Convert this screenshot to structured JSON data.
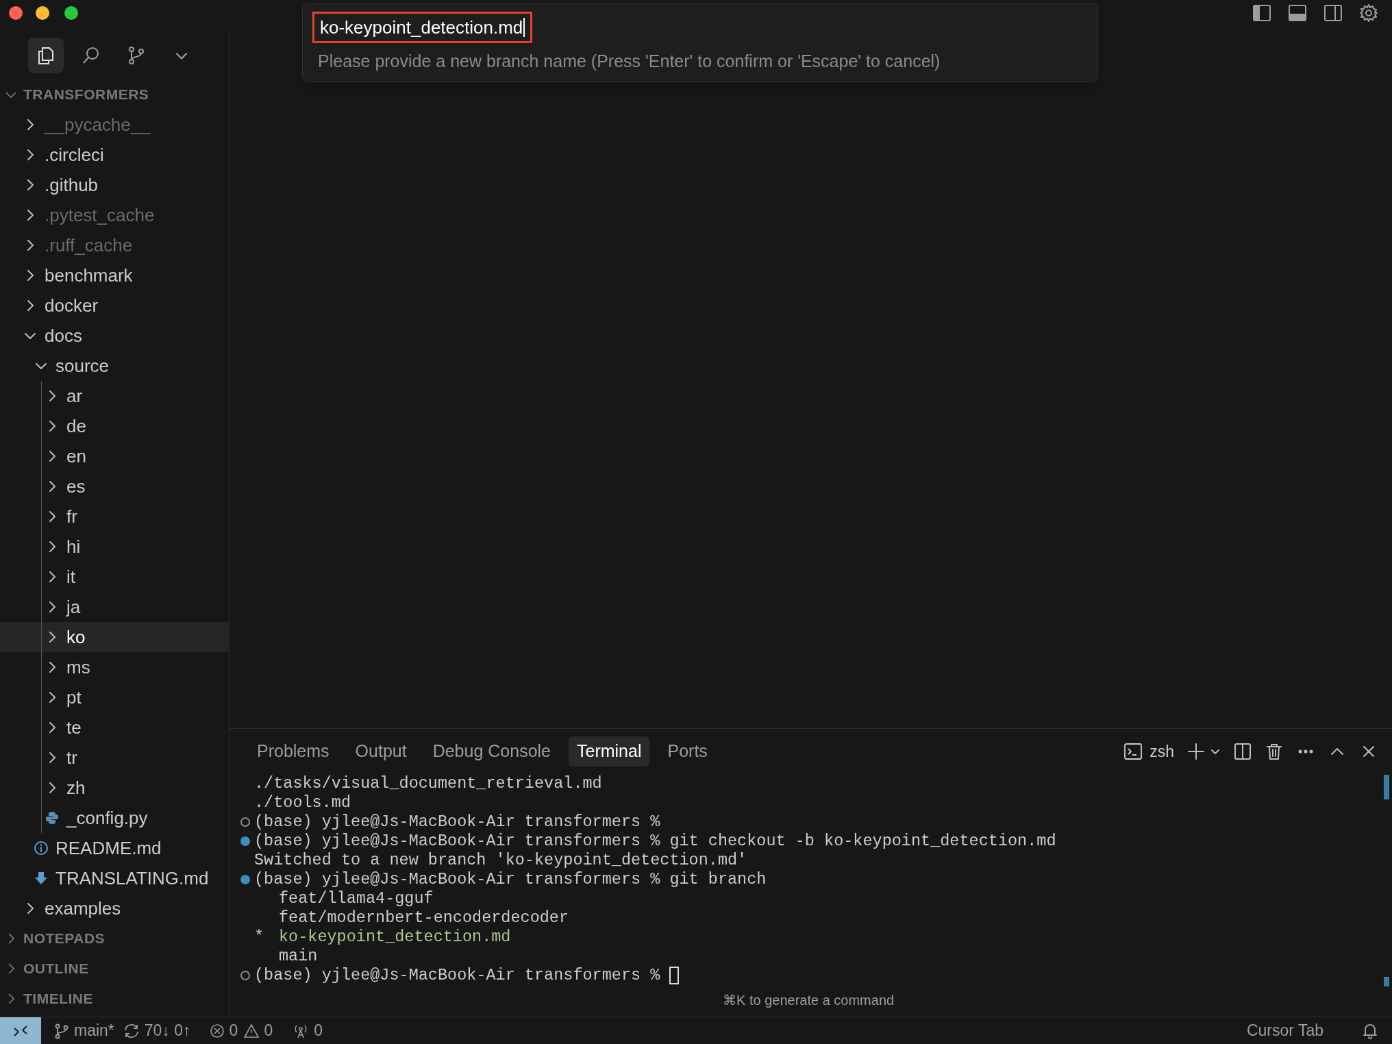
{
  "quick_input": {
    "value": "ko-keypoint_detection.md",
    "message": "Please provide a new branch name (Press 'Enter' to confirm or 'Escape' to cancel)"
  },
  "explorer": {
    "title": "TRANSFORMERS",
    "expanded": true,
    "tree": [
      {
        "name": "__pycache__",
        "kind": "folder",
        "expanded": false,
        "dimmed": true,
        "selected": false
      },
      {
        "name": ".circleci",
        "kind": "folder",
        "expanded": false,
        "dimmed": false,
        "selected": false
      },
      {
        "name": ".github",
        "kind": "folder",
        "expanded": false,
        "dimmed": false,
        "selected": false
      },
      {
        "name": ".pytest_cache",
        "kind": "folder",
        "expanded": false,
        "dimmed": true,
        "selected": false
      },
      {
        "name": ".ruff_cache",
        "kind": "folder",
        "expanded": false,
        "dimmed": true,
        "selected": false
      },
      {
        "name": "benchmark",
        "kind": "folder",
        "expanded": false,
        "dimmed": false,
        "selected": false
      },
      {
        "name": "docker",
        "kind": "folder",
        "expanded": false,
        "dimmed": false,
        "selected": false
      },
      {
        "name": "docs",
        "kind": "folder",
        "expanded": true,
        "dimmed": false,
        "selected": false,
        "children": [
          {
            "name": "source",
            "kind": "folder",
            "expanded": true,
            "dimmed": false,
            "selected": false,
            "children": [
              {
                "name": "ar",
                "kind": "folder",
                "expanded": false,
                "dimmed": false,
                "selected": false
              },
              {
                "name": "de",
                "kind": "folder",
                "expanded": false,
                "dimmed": false,
                "selected": false
              },
              {
                "name": "en",
                "kind": "folder",
                "expanded": false,
                "dimmed": false,
                "selected": false
              },
              {
                "name": "es",
                "kind": "folder",
                "expanded": false,
                "dimmed": false,
                "selected": false
              },
              {
                "name": "fr",
                "kind": "folder",
                "expanded": false,
                "dimmed": false,
                "selected": false
              },
              {
                "name": "hi",
                "kind": "folder",
                "expanded": false,
                "dimmed": false,
                "selected": false
              },
              {
                "name": "it",
                "kind": "folder",
                "expanded": false,
                "dimmed": false,
                "selected": false
              },
              {
                "name": "ja",
                "kind": "folder",
                "expanded": false,
                "dimmed": false,
                "selected": false
              },
              {
                "name": "ko",
                "kind": "folder",
                "expanded": false,
                "dimmed": false,
                "selected": true
              },
              {
                "name": "ms",
                "kind": "folder",
                "expanded": false,
                "dimmed": false,
                "selected": false
              },
              {
                "name": "pt",
                "kind": "folder",
                "expanded": false,
                "dimmed": false,
                "selected": false
              },
              {
                "name": "te",
                "kind": "folder",
                "expanded": false,
                "dimmed": false,
                "selected": false
              },
              {
                "name": "tr",
                "kind": "folder",
                "expanded": false,
                "dimmed": false,
                "selected": false
              },
              {
                "name": "zh",
                "kind": "folder",
                "expanded": false,
                "dimmed": false,
                "selected": false
              },
              {
                "name": "_config.py",
                "kind": "python",
                "dimmed": false,
                "selected": false
              }
            ]
          },
          {
            "name": "README.md",
            "kind": "info",
            "dimmed": false,
            "selected": false
          },
          {
            "name": "TRANSLATING.md",
            "kind": "download",
            "dimmed": false,
            "selected": false
          }
        ]
      },
      {
        "name": "examples",
        "kind": "folder",
        "expanded": false,
        "dimmed": false,
        "selected": false
      }
    ]
  },
  "sections": [
    {
      "title": "NOTEPADS",
      "expanded": false
    },
    {
      "title": "OUTLINE",
      "expanded": false
    },
    {
      "title": "TIMELINE",
      "expanded": false
    }
  ],
  "panel_tabs": [
    {
      "label": "Problems",
      "selected": false
    },
    {
      "label": "Output",
      "selected": false
    },
    {
      "label": "Debug Console",
      "selected": false
    },
    {
      "label": "Terminal",
      "selected": true
    },
    {
      "label": "Ports",
      "selected": false
    }
  ],
  "terminal": {
    "shell": "zsh",
    "lines": [
      {
        "kind": "output",
        "text": "./tasks/visual_document_retrieval.md"
      },
      {
        "kind": "output",
        "text": "./tools.md"
      },
      {
        "kind": "prompt",
        "ran": false,
        "text": "(base) yjlee@Js-MacBook-Air transformers %"
      },
      {
        "kind": "prompt",
        "ran": true,
        "text": "(base) yjlee@Js-MacBook-Air transformers %",
        "command": "git checkout -b ko-keypoint_detection.md"
      },
      {
        "kind": "output",
        "text": "Switched to a new branch 'ko-keypoint_detection.md'"
      },
      {
        "kind": "prompt",
        "ran": true,
        "text": "(base) yjlee@Js-MacBook-Air transformers %",
        "command": "git branch"
      },
      {
        "kind": "branch",
        "name": "feat/llama4-gguf",
        "current": false
      },
      {
        "kind": "branch",
        "name": "feat/modernbert-encoderdecoder",
        "current": false
      },
      {
        "kind": "branch",
        "prefix": "*",
        "name": "ko-keypoint_detection.md",
        "current": true
      },
      {
        "kind": "branch",
        "name": "main",
        "current": false
      },
      {
        "kind": "prompt",
        "ran": false,
        "text": "(base) yjlee@Js-MacBook-Air transformers %",
        "cursor": true
      }
    ],
    "hint": "⌘K to generate a command"
  },
  "status_bar": {
    "branch": "main*",
    "sync": "70↓ 0↑",
    "errors": "0",
    "warnings": "0",
    "ports": "0",
    "right": "Cursor Tab"
  }
}
